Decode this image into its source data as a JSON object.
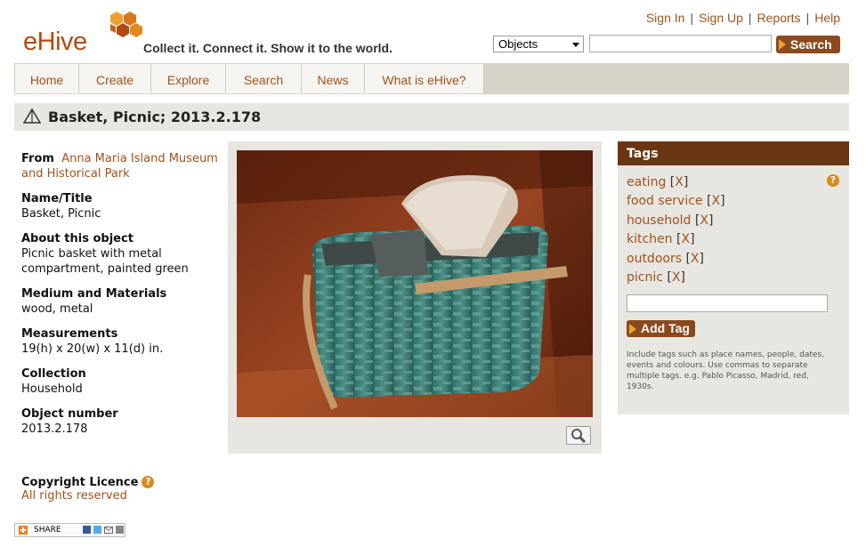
{
  "header": {
    "logo_text": "eHive",
    "tagline": "Collect it. Connect it. Show it to the world.",
    "links": [
      "Sign In",
      "Sign Up",
      "Reports",
      "Help"
    ],
    "search_scope": "Objects",
    "search_placeholder": "",
    "search_button": "Search"
  },
  "nav": {
    "tabs": [
      "Home",
      "Create",
      "Explore",
      "Search",
      "News",
      "What is eHive?"
    ]
  },
  "object": {
    "title": "Basket, Picnic; 2013.2.178",
    "from_label": "From",
    "from_value": "Anna Maria Island Museum and Historical Park",
    "fields": [
      {
        "label": "Name/Title",
        "value": "Basket, Picnic"
      },
      {
        "label": "About this object",
        "value": "Picnic basket with metal compartment, painted green"
      },
      {
        "label": "Medium and Materials",
        "value": "wood, metal"
      },
      {
        "label": "Measurements",
        "value": "19(h) x 20(w) x 11(d) in."
      },
      {
        "label": "Collection",
        "value": "Household"
      },
      {
        "label": "Object number",
        "value": "2013.2.178"
      }
    ],
    "image_icon": "magnifier-icon"
  },
  "tags": {
    "heading": "Tags",
    "items": [
      "eating",
      "food service",
      "household",
      "kitchen",
      "outdoors",
      "picnic"
    ],
    "remove_label": "X",
    "input_value": "",
    "add_button": "Add Tag",
    "help_text": "Include tags such as place names, people, dates, events and colours. Use commas to separate multiple tags. e.g. Pablo Picasso, Madrid, red, 1930s."
  },
  "copyright": {
    "label": "Copyright Licence",
    "value": "All rights reserved"
  },
  "share": {
    "label": "SHARE"
  },
  "colors": {
    "link": "#a0521b",
    "brand_dark": "#6b3612",
    "accent": "#f0a030",
    "panel": "#e8e6e0"
  }
}
